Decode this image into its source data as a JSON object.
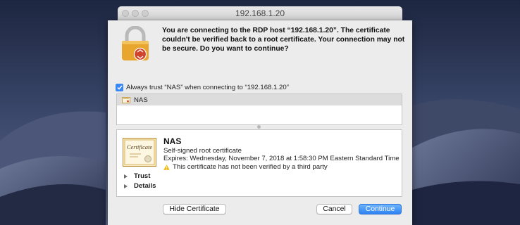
{
  "window": {
    "title": "192.168.1.20"
  },
  "dialog": {
    "message": "You are connecting to the RDP host “192.168.1.20”. The certificate couldn't be verified back to a root certificate. Your connection may not be secure. Do you want to continue?",
    "always_trust_label": "Always trust “NAS” when connecting to “192.168.1.20”",
    "always_trust_checked": true,
    "certificate_list": [
      "NAS"
    ],
    "certificate": {
      "image_text": "Certificate",
      "name": "NAS",
      "type": "Self-signed root certificate",
      "expires": "Expires: Wednesday, November 7, 2018 at 1:58:30 PM Eastern Standard Time",
      "warning": "This certificate has not been verified by a third party"
    },
    "disclosures": [
      "Trust",
      "Details"
    ],
    "buttons": {
      "hide_certificate": "Hide Certificate",
      "cancel": "Cancel",
      "continue": "Continue"
    }
  },
  "colors": {
    "accent": "#3b87f5",
    "lock_gold": "#e8a62f",
    "badge_red": "#d2432b",
    "warning_yellow": "#f2b90f"
  }
}
